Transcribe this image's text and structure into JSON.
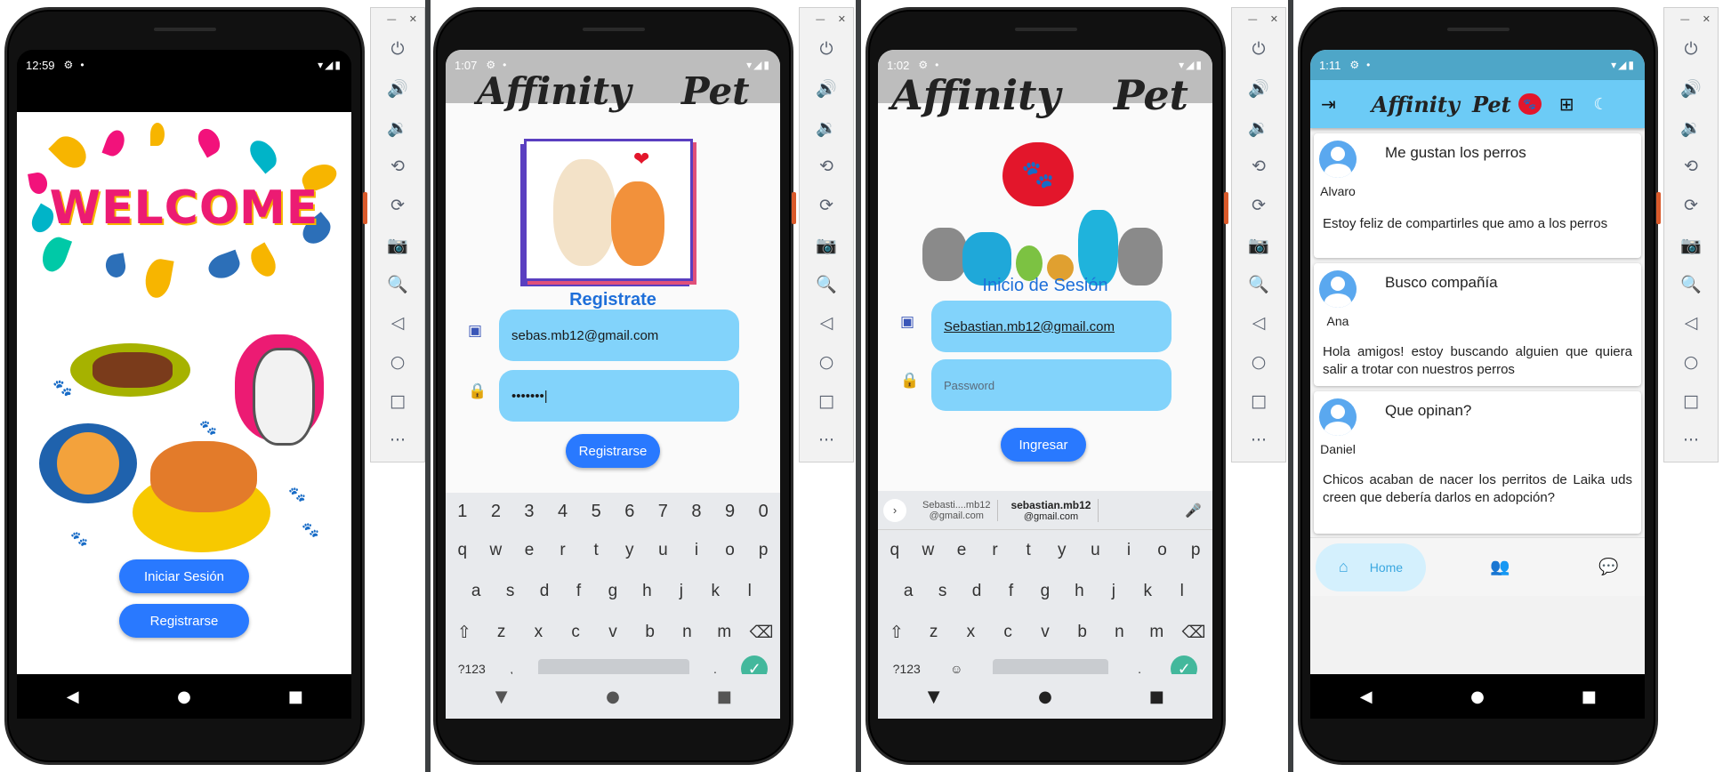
{
  "colors": {
    "accent_blue": "#2979ff",
    "field_blue": "#82d3fb",
    "title_blue": "#1e6fd9",
    "appbar_blue": "#6ccbf6",
    "success_green": "#43b89c"
  },
  "emulator_toolbar": {
    "window_controls": [
      "—",
      "✕"
    ],
    "icons": [
      "power-icon",
      "volume-up-icon",
      "volume-down-icon",
      "rotate-left-icon",
      "rotate-right-icon",
      "camera-icon",
      "zoom-icon",
      "back-icon",
      "home-icon",
      "overview-icon",
      "more-icon"
    ]
  },
  "screen1": {
    "status_time": "12:59",
    "welcome_text": "WELCOME",
    "login_button": "Iniciar Sesión",
    "register_button": "Registrarse"
  },
  "screen2": {
    "status_time": "1:07",
    "logo_word1": "Affinity",
    "logo_word2": "Pet",
    "title": "Registrate",
    "email_value": "sebas.mb12@gmail.com",
    "password_value": "•••••••|",
    "submit_button": "Registrarse"
  },
  "screen3": {
    "status_time": "1:02",
    "logo_word1": "Affinity",
    "logo_word2": "Pet",
    "title": "Inicio de Sesión",
    "email_value": "Sebastian.mb12@gmail.com",
    "password_placeholder": "Password",
    "submit_button": "Ingresar",
    "suggestion1_main": "Sebasti....mb12",
    "suggestion1_sub": "@gmail.com",
    "suggestion2_main": "sebastian.mb12",
    "suggestion2_sub": "@gmail.com"
  },
  "keyboard": {
    "num_row": [
      "1",
      "2",
      "3",
      "4",
      "5",
      "6",
      "7",
      "8",
      "9",
      "0"
    ],
    "row1": [
      "q",
      "w",
      "e",
      "r",
      "t",
      "y",
      "u",
      "i",
      "o",
      "p"
    ],
    "row2": [
      "a",
      "s",
      "d",
      "f",
      "g",
      "h",
      "j",
      "k",
      "l"
    ],
    "row3": [
      "z",
      "x",
      "c",
      "v",
      "b",
      "n",
      "m"
    ],
    "symbols_key": "?123",
    "comma_key": ",",
    "period_key": "."
  },
  "screen4": {
    "status_time": "1:11",
    "appbar_word1": "Affinity",
    "appbar_word2": "Pet",
    "posts": [
      {
        "user": "Alvaro",
        "title": "Me gustan los perros",
        "body": "Estoy feliz de compartirles que amo a los perros"
      },
      {
        "user": "Ana",
        "title": "Busco compañía",
        "body": "Hola amigos! estoy buscando alguien que quiera salir a trotar con nuestros perros"
      },
      {
        "user": "Daniel",
        "title": "Que opinan?",
        "body": "Chicos acaban de nacer los perritos de Laika uds creen que debería darlos en adopción?"
      }
    ],
    "nav_home_label": "Home"
  }
}
